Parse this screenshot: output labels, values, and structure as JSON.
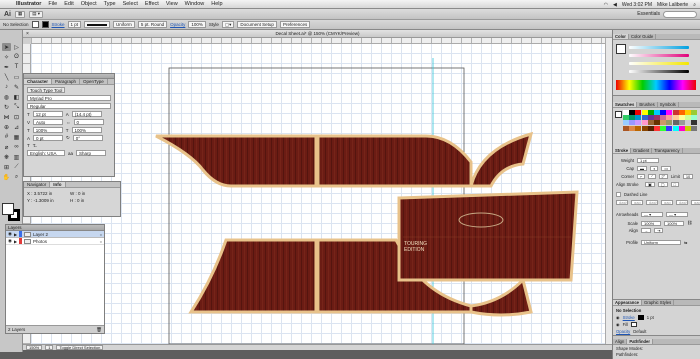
{
  "menubar": {
    "app": "Illustrator",
    "items": [
      "File",
      "Edit",
      "Object",
      "Type",
      "Select",
      "Effect",
      "View",
      "Window",
      "Help"
    ],
    "clock": "Wed 3:02 PM",
    "user": "Mike Laliberte"
  },
  "appbar": {
    "logo": "Ai",
    "workspace": "Essentials"
  },
  "controlbar": {
    "selection": "No Selection",
    "stroke_label": "Stroke",
    "stroke_weight": "1 pt",
    "brush": "Uniform",
    "brush_profile": "5 pt. Round",
    "opacity_label": "Opacity",
    "opacity_value": "100%",
    "style_label": "Style",
    "doc_setup": "Document Setup",
    "preferences": "Preferences"
  },
  "document": {
    "tab_title": "Decal Sheet.ai* @ 150% (CMYK/Preview)"
  },
  "decal": {
    "badge_line1": "TOURING",
    "badge_line2": "EDITION"
  },
  "colors": {
    "wood": "#6b1c14",
    "edge": "#e8c28a",
    "guide": "#33c6d8",
    "artboard": "#555555"
  },
  "character_panel": {
    "tabs": [
      "Character",
      "Paragraph",
      "OpenType"
    ],
    "touch_tool": "Touch Type Tool",
    "font_family": "Myriad Pro",
    "font_style": "Regular",
    "size": "12 pt",
    "leading": "(14.4 pt)",
    "kerning": "Auto",
    "tracking": "0",
    "horiz_scale": "100%",
    "vert_scale": "100%",
    "baseline": "0 pt",
    "rotation": "0°",
    "language": "English: USA",
    "antialias": "Sharp"
  },
  "navigator_panel": {
    "tabs": [
      "Navigator",
      "Info"
    ],
    "x": "X : 3.5722 in",
    "y": "Y : -1.3009 in",
    "w": "W : 0 in",
    "h": "H : 0 in"
  },
  "layers_panel": {
    "title": "Layers",
    "layers": [
      {
        "name": "Layer 2",
        "color": "#3a6ee8",
        "selected": true
      },
      {
        "name": "Photos",
        "color": "#e23a3a",
        "selected": false
      }
    ],
    "footer": "2 Layers"
  },
  "statusbar": {
    "zoom": "150%",
    "page": "1",
    "tool": "Toggle Direct Selection"
  },
  "dock": {
    "color_tabs": [
      "Color",
      "Color Guide"
    ],
    "swatch_tabs": [
      "Swatches",
      "Brushes",
      "Symbols"
    ],
    "stroke_tabs": [
      "Stroke",
      "Gradient",
      "Transparency"
    ],
    "stroke": {
      "weight_label": "Weight",
      "weight": "1 pt",
      "cap_label": "Cap",
      "corner_label": "Corner",
      "limit_label": "Limit",
      "limit": "10",
      "align_label": "Align Stroke",
      "dashed_label": "Dashed Line",
      "dash_labels": [
        "dash",
        "gap",
        "dash",
        "gap",
        "dash",
        "gap"
      ],
      "arrowheads_label": "Arrowheads",
      "scale_label": "Scale",
      "scale_a": "100%",
      "scale_b": "100%",
      "align_label2": "Align",
      "profile_label": "Profile",
      "profile_value": "Uniform"
    },
    "appearance_tabs": [
      "Appearance",
      "Graphic Styles"
    ],
    "appearance": {
      "header": "No Selection",
      "stroke_label": "Stroke",
      "stroke_value": "1 pt",
      "fill_label": "Fill",
      "opacity_label": "Opacity",
      "opacity_value": "Default"
    },
    "path_tabs": [
      "Align",
      "Pathfinder"
    ],
    "shape_modes": "Shape Modes:",
    "pathfinders": "Pathfinders:"
  }
}
